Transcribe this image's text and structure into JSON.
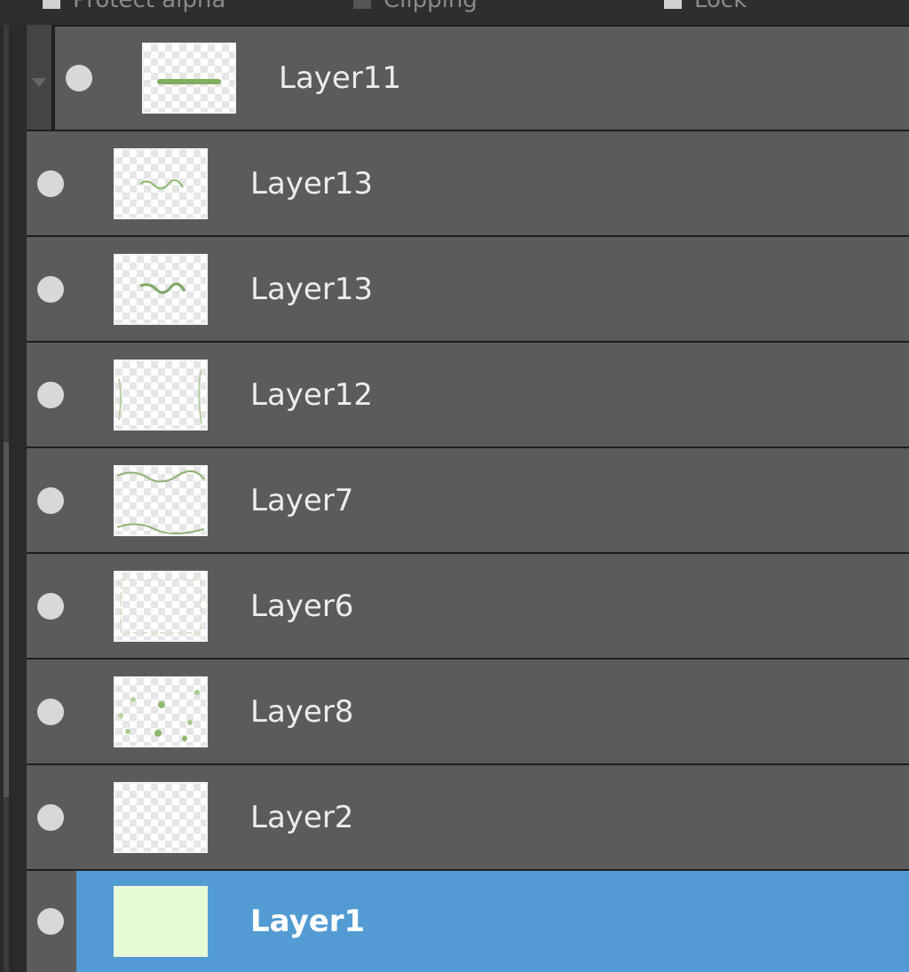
{
  "topbar": {
    "items": [
      "Protect alpha",
      "Clipping",
      "Lock"
    ]
  },
  "layers": [
    {
      "name": "Layer11",
      "visible": true,
      "selected": false,
      "child": true,
      "thumb": "green-stroke"
    },
    {
      "name": "Layer13",
      "visible": true,
      "selected": false,
      "child": false,
      "thumb": "green-scribble"
    },
    {
      "name": "Layer13",
      "visible": true,
      "selected": false,
      "child": false,
      "thumb": "green-scribble"
    },
    {
      "name": "Layer12",
      "visible": true,
      "selected": false,
      "child": false,
      "thumb": "faint-border"
    },
    {
      "name": "Layer7",
      "visible": true,
      "selected": false,
      "child": false,
      "thumb": "wavy-edges"
    },
    {
      "name": "Layer6",
      "visible": true,
      "selected": false,
      "child": false,
      "thumb": "faint-border"
    },
    {
      "name": "Layer8",
      "visible": true,
      "selected": false,
      "child": false,
      "thumb": "dots"
    },
    {
      "name": "Layer2",
      "visible": true,
      "selected": false,
      "child": false,
      "thumb": "empty"
    },
    {
      "name": "Layer1",
      "visible": true,
      "selected": true,
      "child": false,
      "thumb": "solid-light-green"
    }
  ],
  "colors": {
    "selection": "#539bd3",
    "row": "#5b5b5b",
    "stroke": "#7fae5e"
  }
}
